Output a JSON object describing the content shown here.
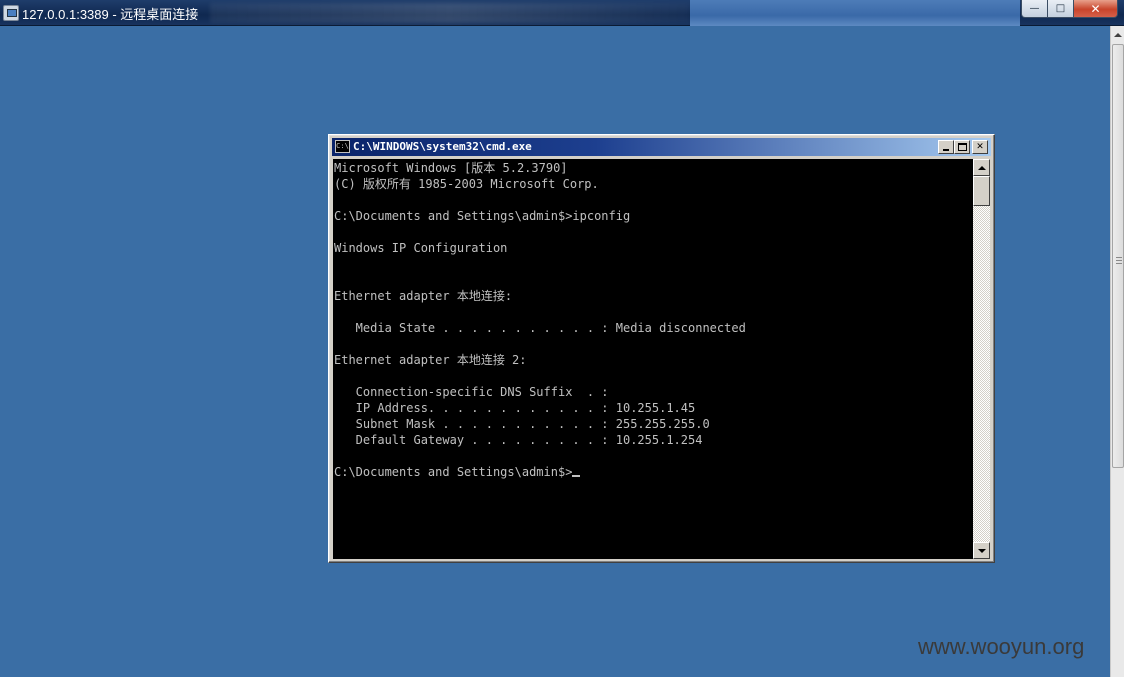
{
  "rdp_window": {
    "title": "127.0.0.1:3389 - 远程桌面连接",
    "buttons": {
      "minimize": "—",
      "maximize": "□",
      "close": "✕"
    }
  },
  "cmd_window": {
    "title": "C:\\WINDOWS\\system32\\cmd.exe",
    "icon_label": "C:\\",
    "console_lines": [
      "Microsoft Windows [版本 5.2.3790]",
      "(C) 版权所有 1985-2003 Microsoft Corp.",
      "",
      "C:\\Documents and Settings\\admin$>ipconfig",
      "",
      "Windows IP Configuration",
      "",
      "",
      "Ethernet adapter 本地连接:",
      "",
      "   Media State . . . . . . . . . . . : Media disconnected",
      "",
      "Ethernet adapter 本地连接 2:",
      "",
      "   Connection-specific DNS Suffix  . :",
      "   IP Address. . . . . . . . . . . . : 10.255.1.45",
      "   Subnet Mask . . . . . . . . . . . : 255.255.255.0",
      "   Default Gateway . . . . . . . . . : 10.255.1.254",
      "",
      "C:\\Documents and Settings\\admin$>"
    ]
  },
  "watermark": "www.wooyun.org",
  "colors": {
    "desktop": "#3a6ea5",
    "console_bg": "#000000",
    "console_fg": "#c0c0c0",
    "cmd_title_start": "#0a246a",
    "cmd_title_end": "#a6caf0"
  }
}
